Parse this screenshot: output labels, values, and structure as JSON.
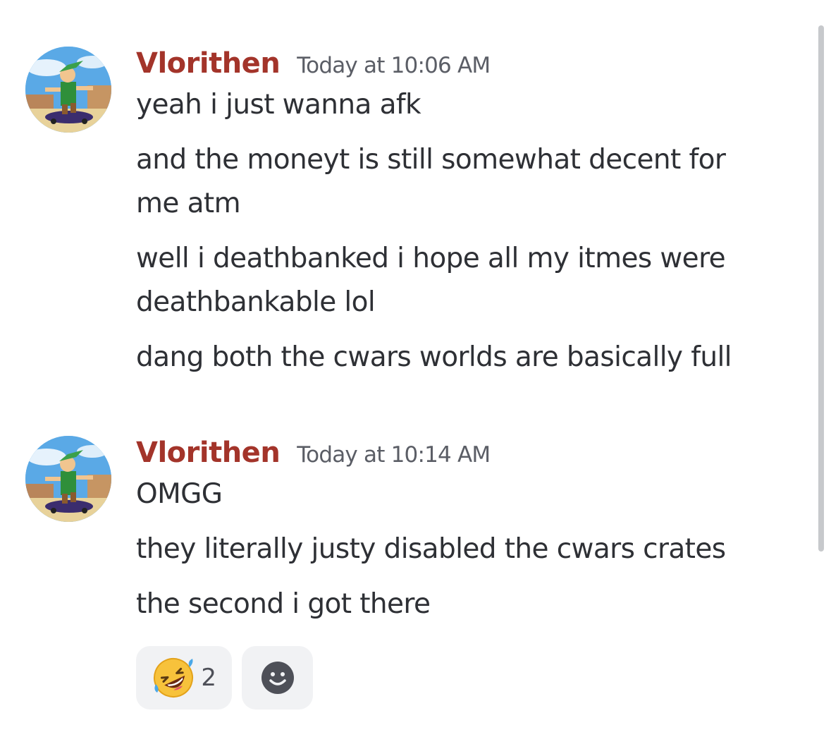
{
  "messages": [
    {
      "author": "Vlorithen",
      "timestamp": "Today at 10:06 AM",
      "lines": [
        "yeah i just wanna afk",
        "and the moneyt is  still somewhat decent for",
        "me atm",
        "well i deathbanked i hope all my itmes were",
        "deathbankable lol",
        "dang both the cwars worlds are basically full"
      ]
    },
    {
      "author": "Vlorithen",
      "timestamp": "Today at 10:14 AM",
      "lines": [
        "OMGG",
        "they literally justy disabled the cwars crates",
        "the second i got there"
      ]
    }
  ],
  "reactions": [
    {
      "emoji": "rolling-on-the-floor-laughing",
      "count": "2"
    },
    {
      "emoji": "add-reaction-smiley",
      "count": ""
    }
  ],
  "colors": {
    "username": "#a3342a",
    "timestamp": "#5b5e66",
    "text": "#2e3035",
    "reaction_bg": "#f1f2f4"
  }
}
